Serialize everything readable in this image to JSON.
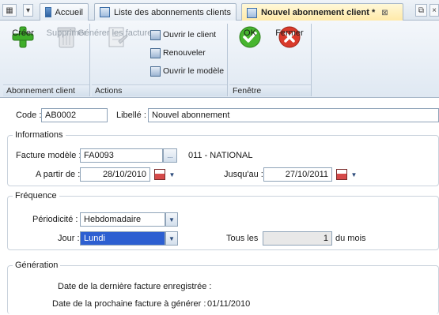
{
  "tabstrip": {
    "tabs": [
      {
        "label": "Accueil"
      },
      {
        "label": "Liste des abonnements clients"
      },
      {
        "label": "Nouvel abonnement client *",
        "close": "⊠"
      }
    ]
  },
  "ribbon": {
    "groups": {
      "abonnement": {
        "label": "Abonnement client",
        "creer": "Créer",
        "supprimer": "Supprimer"
      },
      "actions": {
        "label": "Actions",
        "generer": "Générer les factures",
        "ouvrir_client": "Ouvrir le client",
        "renouveler": "Renouveler",
        "ouvrir_modele": "Ouvrir le modèle"
      },
      "fenetre": {
        "label": "Fenêtre",
        "ok": "OK",
        "fermer": "Fermer"
      }
    }
  },
  "form": {
    "code_label": "Code :",
    "code_value": "AB0002",
    "libelle_label": "Libellé :",
    "libelle_value": "Nouvel abonnement",
    "informations": {
      "title": "Informations",
      "facture_label": "Facture modèle :",
      "facture_value": "FA0093",
      "ellipsis": "...",
      "facture_desc": "011 - NATIONAL",
      "apartir_label": "A partir de :",
      "apartir_value": "28/10/2010",
      "jusquau_label": "Jusqu'au :",
      "jusquau_value": "27/10/2011"
    },
    "frequence": {
      "title": "Fréquence",
      "periodicite_label": "Périodicité :",
      "periodicite_value": "Hebdomadaire",
      "jour_label": "Jour :",
      "jour_value": "Lundi",
      "tousles_label": "Tous les",
      "tousles_value": "1",
      "unit": "du mois"
    },
    "generation": {
      "title": "Génération",
      "derniere_label": "Date de la dernière facture enregistrée :",
      "prochaine_label": "Date de la prochaine facture à générer :",
      "prochaine_value": "01/11/2010"
    }
  }
}
